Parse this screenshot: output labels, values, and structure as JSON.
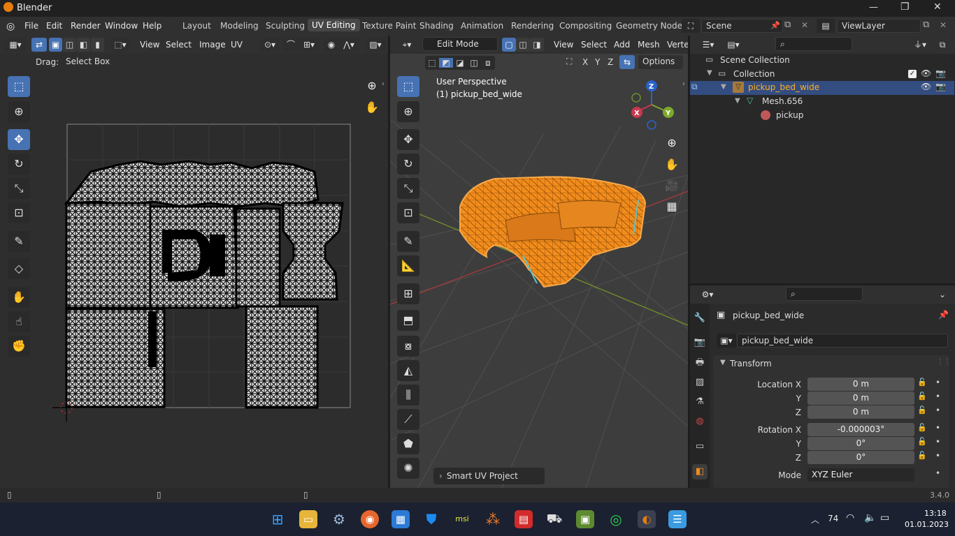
{
  "titlebar": {
    "app": "Blender",
    "min": "—",
    "max": "❐",
    "close": "✕"
  },
  "menu": {
    "file": "File",
    "edit": "Edit",
    "render": "Render",
    "window": "Window",
    "help": "Help"
  },
  "workspaces": [
    "Layout",
    "Modeling",
    "Sculpting",
    "UV Editing",
    "Texture Paint",
    "Shading",
    "Animation",
    "Rendering",
    "Compositing",
    "Geometry Node"
  ],
  "active_workspace": "UV Editing",
  "scene": {
    "name": "Scene",
    "view_layer": "ViewLayer"
  },
  "uv_editor": {
    "menus": [
      "View",
      "Select",
      "Image",
      "UV"
    ],
    "drag_label": "Drag:",
    "drag_value": "Select Box"
  },
  "viewport": {
    "mode": "Edit Mode",
    "menus": [
      "View",
      "Select",
      "Add",
      "Mesh",
      "Verte"
    ],
    "xyz": [
      "X",
      "Y",
      "Z"
    ],
    "options": "Options",
    "perspective": "User Perspective",
    "object": "(1) pickup_bed_wide",
    "axes": {
      "x": "X",
      "y": "Y",
      "z": "Z"
    },
    "operator_panel": "Smart UV Project"
  },
  "outliner": {
    "search_placeholder": "",
    "scene_collection": "Scene Collection",
    "collection": "Collection",
    "object": "pickup_bed_wide",
    "mesh": "Mesh.656",
    "material": "pickup"
  },
  "properties": {
    "object_name": "pickup_bed_wide",
    "data_name": "pickup_bed_wide",
    "transform": "Transform",
    "location": {
      "label_x": "Location X",
      "label_y": "Y",
      "label_z": "Z",
      "x": "0 m",
      "y": "0 m",
      "z": "0 m"
    },
    "rotation": {
      "label_x": "Rotation X",
      "label_y": "Y",
      "label_z": "Z",
      "x": "-0.000003°",
      "y": "0°",
      "z": "0°"
    },
    "mode_label": "Mode",
    "mode_value": "XYZ Euler"
  },
  "statusbar": {
    "version": "3.4.0"
  },
  "taskbar": {
    "tray_count": "74",
    "time": "13:18",
    "date": "01.01.2023"
  },
  "colors": {
    "accent": "#4772b3",
    "mesh": "#f28c1c",
    "grid_x": "#a33a3a",
    "grid_y": "#6f8d2a",
    "bg": "#1d1d1d"
  }
}
